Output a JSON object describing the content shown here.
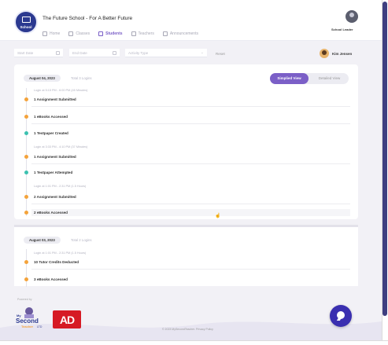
{
  "header": {
    "logo_text": "School",
    "school_name": "The Future School - For A Better Future",
    "nav": [
      {
        "label": "Home",
        "icon": "home-icon"
      },
      {
        "label": "Classes",
        "icon": "classes-icon"
      },
      {
        "label": "Students",
        "icon": "students-icon",
        "active": true
      },
      {
        "label": "Teachers",
        "icon": "teachers-icon"
      },
      {
        "label": "Announcements",
        "icon": "megaphone-icon"
      }
    ],
    "user_role": "School Leader"
  },
  "filters": {
    "start_date_placeholder": "Start Date",
    "end_date_placeholder": "End Date",
    "activity_type_placeholder": "Activity Type",
    "reset_label": "Reset",
    "student_name": "Kim Jensen"
  },
  "view_toggle": {
    "simplified": "Simplied View",
    "detailed": "Detailed View"
  },
  "days": [
    {
      "date": "August 04, 2023",
      "logins": "Total 3 Logins",
      "entries": [
        {
          "kind": "session",
          "text": "Login at 5:15 PM - 6:00 PM (45 Minutes)"
        },
        {
          "kind": "event",
          "text": "1 Assignment Submitted",
          "color": "orange"
        },
        {
          "kind": "event",
          "text": "1 eBooks Accessed",
          "color": "orange"
        },
        {
          "kind": "event",
          "text": "1 Testpaper Created",
          "color": "teal"
        },
        {
          "kind": "session",
          "text": "Login at 3:33 PM - 4:10 PM (37 Minutes)"
        },
        {
          "kind": "event",
          "text": "1 Assignment Submitted",
          "color": "orange"
        },
        {
          "kind": "event",
          "text": "1 Testpaper Attempted",
          "color": "teal"
        },
        {
          "kind": "session",
          "text": "Login at 1:01 PM - 2:31 PM (1.5 Hours)"
        },
        {
          "kind": "event",
          "text": "2 Assignment Submitted",
          "color": "orange"
        },
        {
          "kind": "event",
          "text": "2 eBooks Accessed",
          "color": "orange"
        }
      ]
    },
    {
      "date": "August 03, 2023",
      "logins": "Total 2 Logins",
      "entries": [
        {
          "kind": "session",
          "text": "Login at 1:01 PM - 2:31 PM (1.5 Hours)"
        },
        {
          "kind": "event",
          "text": "10 Tutor Credits Deducted",
          "color": "orange"
        },
        {
          "kind": "event",
          "text": "3 eBooks Accessed",
          "color": "orange"
        }
      ]
    }
  ],
  "footer": {
    "powered_by": "Powered by",
    "brand_line1": "My",
    "brand_line2": "Second",
    "brand_line3": "Teacher",
    "brand_line4": "LTD",
    "partner_logo_text": "AD",
    "copyright": "© 2023 MySecondTeacher. Privacy Policy"
  },
  "colors": {
    "accent": "#7b5fc7",
    "chat_button": "#3a2fb0",
    "orange_dot": "#f4a33b",
    "teal_dot": "#3cc1b0",
    "partner_red": "#d61a24"
  }
}
